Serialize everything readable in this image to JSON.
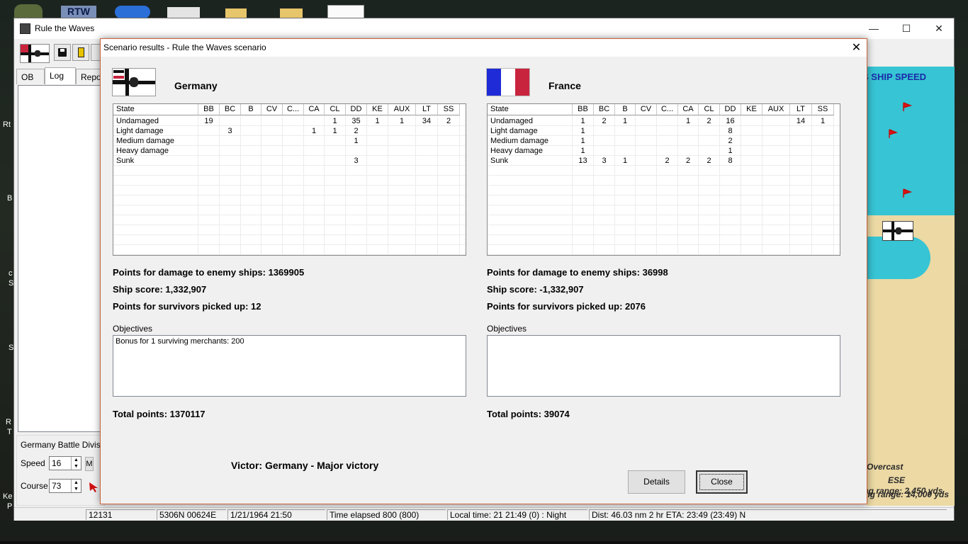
{
  "desktop": {
    "left_letters": [
      "Rt",
      "B",
      "c",
      "S",
      "S",
      "R",
      "T",
      "Ke",
      "P"
    ]
  },
  "main_window": {
    "title": "Rule the Waves",
    "controls": {
      "minimize": "—",
      "maximize": "☐",
      "close": "✕"
    },
    "tabs": [
      "OB",
      "Log",
      "Repor"
    ],
    "division_label": "Germany Battle Division",
    "speed_label": "Speed",
    "speed_value": "16",
    "course_label": "Course",
    "course_value": "73",
    "move_button": "M"
  },
  "map": {
    "title_fragment": "S SHIP SPEED",
    "weather": "Overcast",
    "wind": "ESE",
    "range1": "ing range: 14,000 yds",
    "range2": "ing range: 2,450 yds"
  },
  "statusbar": {
    "cells": [
      "12131",
      "5306N 00624E",
      "1/21/1964 21:50",
      "Time elapsed 800 (800)",
      "Local time: 21 21:49 (0) : Night",
      "Dist: 46.03 nm 2 hr ETA: 23:49 (23:49) N"
    ]
  },
  "dialog": {
    "title": "Scenario results - Rule the Waves scenario",
    "close": "✕",
    "columns": [
      "State",
      "BB",
      "BC",
      "B",
      "CV",
      "C...",
      "CA",
      "CL",
      "DD",
      "KE",
      "AUX",
      "LT",
      "SS"
    ],
    "objectives_label": "Objectives",
    "victor": "Victor: Germany - Major victory",
    "details_button": "Details",
    "close_button": "Close",
    "left": {
      "name": "Germany",
      "rows": [
        [
          "Undamaged",
          "19",
          "",
          "",
          "",
          "",
          "",
          "1",
          "35",
          "1",
          "1",
          "34",
          "2"
        ],
        [
          "Light damage",
          "",
          "3",
          "",
          "",
          "",
          "1",
          "1",
          "2",
          "",
          "",
          "",
          ""
        ],
        [
          "Medium damage",
          "",
          "",
          "",
          "",
          "",
          "",
          "",
          "1",
          "",
          "",
          "",
          ""
        ],
        [
          "Heavy damage",
          "",
          "",
          "",
          "",
          "",
          "",
          "",
          "",
          "",
          "",
          "",
          ""
        ],
        [
          "Sunk",
          "",
          "",
          "",
          "",
          "",
          "",
          "",
          "3",
          "",
          "",
          "",
          ""
        ]
      ],
      "points_damage": "Points for damage to enemy ships: 1369905",
      "ship_score": "Ship score: 1,332,907",
      "points_survivors": "Points for survivors picked up: 12",
      "objectives_text": "Bonus for 1 surviving merchants: 200",
      "total": "Total points: 1370117"
    },
    "right": {
      "name": "France",
      "rows": [
        [
          "Undamaged",
          "1",
          "2",
          "1",
          "",
          "",
          "1",
          "2",
          "16",
          "",
          "",
          "14",
          "1"
        ],
        [
          "Light damage",
          "1",
          "",
          "",
          "",
          "",
          "",
          "",
          "8",
          "",
          "",
          "",
          ""
        ],
        [
          "Medium damage",
          "1",
          "",
          "",
          "",
          "",
          "",
          "",
          "2",
          "",
          "",
          "",
          ""
        ],
        [
          "Heavy damage",
          "1",
          "",
          "",
          "",
          "",
          "",
          "",
          "1",
          "",
          "",
          "",
          ""
        ],
        [
          "Sunk",
          "13",
          "3",
          "1",
          "",
          "2",
          "2",
          "2",
          "8",
          "",
          "",
          "",
          ""
        ]
      ],
      "points_damage": "Points for damage to enemy ships: 36998",
      "ship_score": "Ship score: -1,332,907",
      "points_survivors": "Points for survivors picked up: 2076",
      "objectives_text": "",
      "total": "Total points: 39074"
    }
  },
  "colors": {
    "france_blue": "#1f2bd6",
    "france_red": "#c8243e",
    "sea": "#37c4d4",
    "land": "#ecd9a4",
    "dialog_border": "#c9643c"
  }
}
